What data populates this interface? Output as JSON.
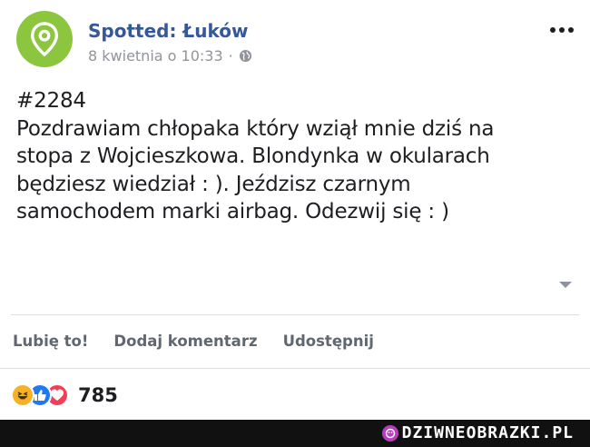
{
  "post": {
    "page_name": "Spotted: Łuków",
    "timestamp": "8 kwietnia o 10:33",
    "separator": "·",
    "privacy_icon": "globe-icon",
    "avatar_icon": "map-pin-icon",
    "avatar_color": "#8cc63f",
    "text_lines": [
      "#2284",
      "Pozdrawiam chłopaka który wziął mnie dziś na",
      "stopa z Wojcieszkowa. Blondynka w okularach",
      "będziesz wiedział : ). Jeździsz czarnym",
      "samochodem marki airbag. Odezwij się : )"
    ]
  },
  "actions": {
    "like": "Lubię to!",
    "comment": "Dodaj komentarz",
    "share": "Udostępnij"
  },
  "reactions": {
    "icons": [
      "haha-icon",
      "like-icon",
      "love-icon"
    ],
    "count": "785"
  },
  "watermark": {
    "text": "DZIWNEOBRAZKI.PL",
    "color": "#b83cc0"
  }
}
